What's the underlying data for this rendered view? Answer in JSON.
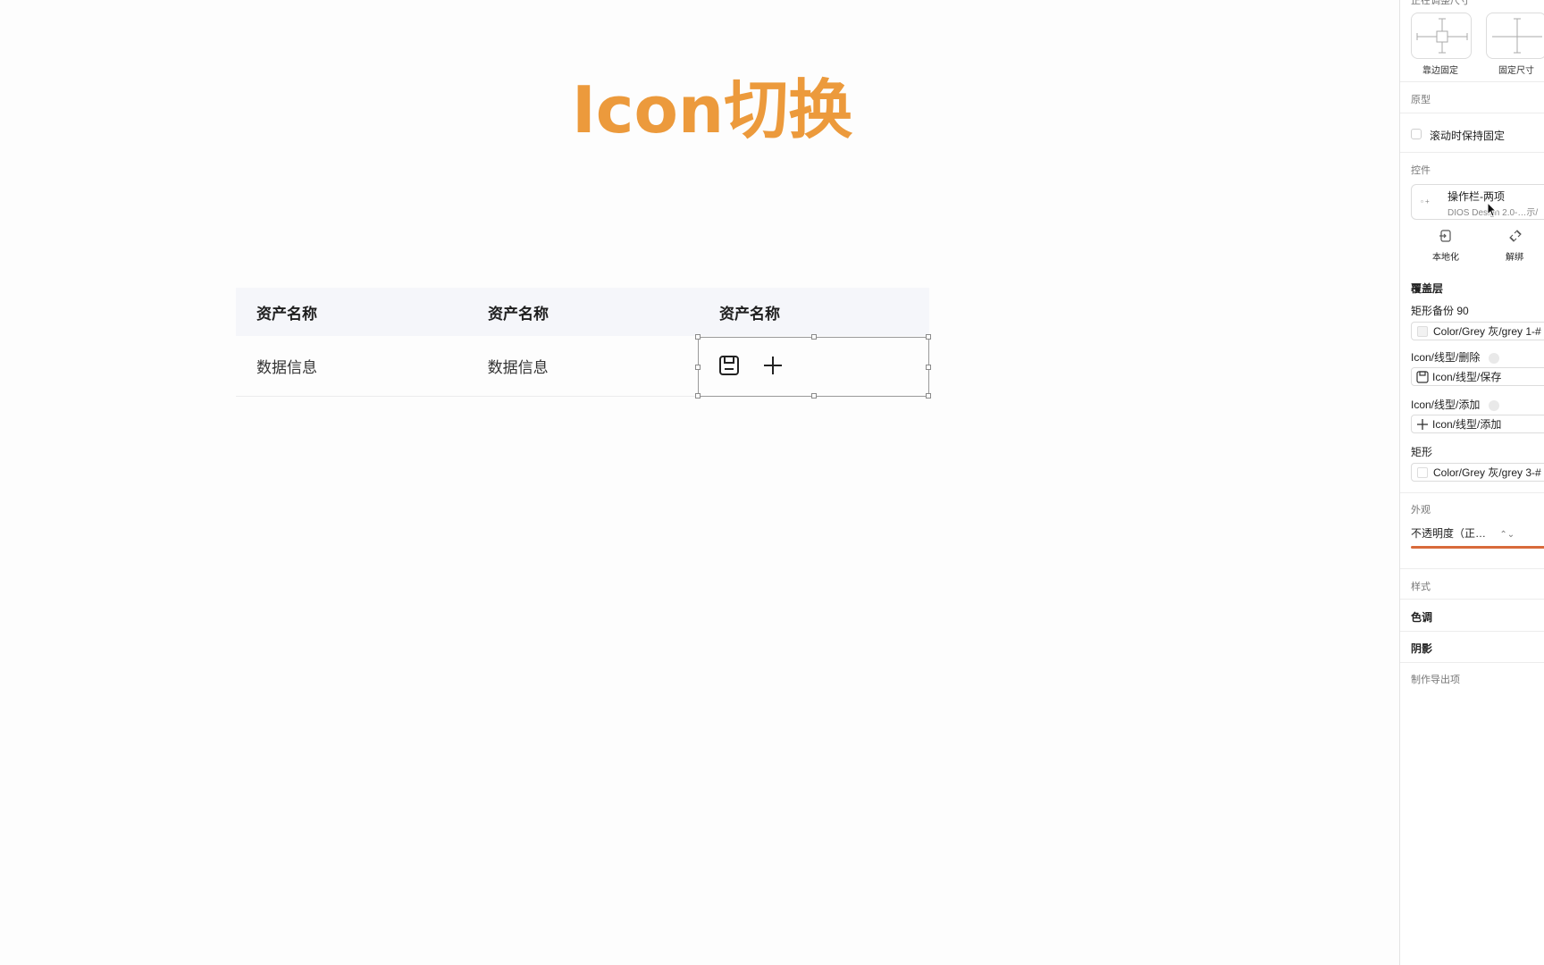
{
  "canvas": {
    "title": "Icon切换",
    "table": {
      "headers": [
        "资产名称",
        "资产名称",
        "资产名称"
      ],
      "row": [
        "数据信息",
        "数据信息"
      ],
      "icons": [
        "save-icon",
        "plus-icon"
      ]
    }
  },
  "panel": {
    "top_section_label": "正在调整尺寸",
    "resize_options": [
      "靠边固定",
      "固定尺寸"
    ],
    "prototype": {
      "heading": "原型",
      "fixed_on_scroll": "滚动时保持固定"
    },
    "control": {
      "heading": "控件",
      "component_name": "操作栏-两项",
      "component_source": "DIOS Design 2.0-…示/",
      "localize": "本地化",
      "unlink": "解绑"
    },
    "overlay": {
      "heading": "覆盖层",
      "rect_backup_label": "矩形备份 90",
      "rect_backup_value": "Color/Grey 灰/grey 1-#",
      "delete_icon_label": "Icon/线型/删除",
      "delete_icon_value": "Icon/线型/保存",
      "add_icon_label": "Icon/线型/添加",
      "add_icon_value": "Icon/线型/添加",
      "rect_label": "矩形",
      "rect_value": "Color/Grey 灰/grey 3-#"
    },
    "appearance": {
      "heading": "外观",
      "opacity": "不透明度（正…"
    },
    "style": {
      "heading": "样式",
      "tint": "色调",
      "shadow": "阴影"
    },
    "export": "制作导出项"
  },
  "colors": {
    "title": "#ec9a3c",
    "accent_line": "#d86a3a",
    "header_bg": "#f5f6fa"
  }
}
